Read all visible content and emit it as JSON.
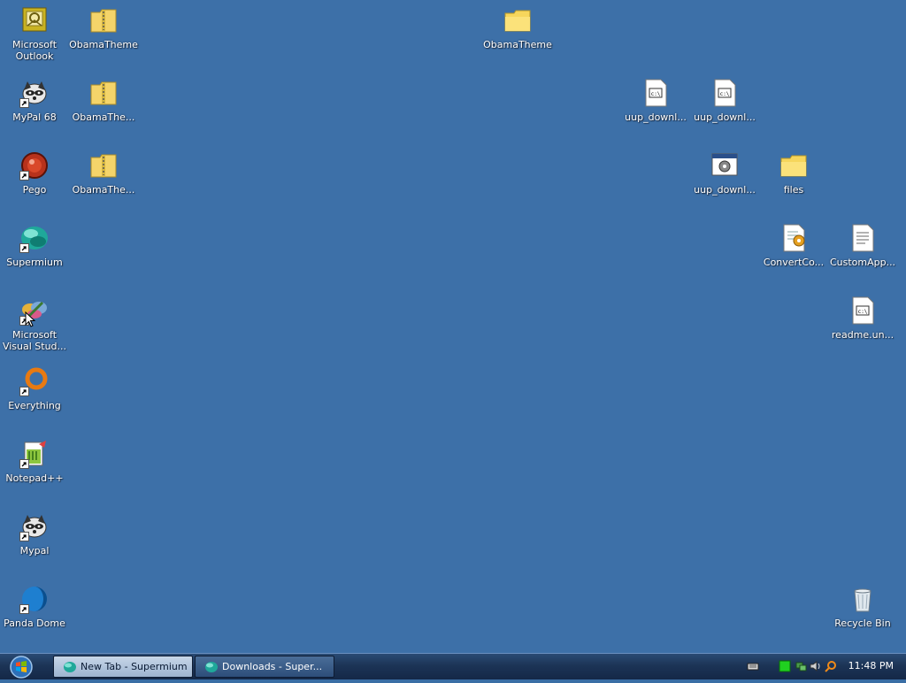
{
  "desktop": {
    "icons": [
      {
        "id": "outlook",
        "label": "Microsoft Outlook"
      },
      {
        "id": "obama1",
        "label": "ObamaTheme"
      },
      {
        "id": "obama-folder",
        "label": "ObamaTheme"
      },
      {
        "id": "mypal68",
        "label": "MyPal 68"
      },
      {
        "id": "obama2",
        "label": "ObamaThe..."
      },
      {
        "id": "uup1",
        "label": "uup_downl..."
      },
      {
        "id": "uup2",
        "label": "uup_downl..."
      },
      {
        "id": "pego",
        "label": "Pego"
      },
      {
        "id": "obama3",
        "label": "ObamaThe..."
      },
      {
        "id": "uup3",
        "label": "uup_downl..."
      },
      {
        "id": "files",
        "label": "files"
      },
      {
        "id": "supermium",
        "label": "Supermium"
      },
      {
        "id": "convertco",
        "label": "ConvertCo..."
      },
      {
        "id": "customapp",
        "label": "CustomApp..."
      },
      {
        "id": "vstudio",
        "label": "Microsoft Visual Stud..."
      },
      {
        "id": "readme",
        "label": "readme.un..."
      },
      {
        "id": "everything",
        "label": "Everything"
      },
      {
        "id": "notepadpp",
        "label": "Notepad++"
      },
      {
        "id": "mypal",
        "label": "Mypal"
      },
      {
        "id": "pandadome",
        "label": "Panda Dome"
      },
      {
        "id": "recyclebin",
        "label": "Recycle Bin"
      }
    ]
  },
  "taskbar": {
    "buttons": [
      {
        "label": "New Tab - Supermium",
        "active": true
      },
      {
        "label": "Downloads - Super...",
        "active": false
      }
    ],
    "clock": "11:48 PM"
  }
}
